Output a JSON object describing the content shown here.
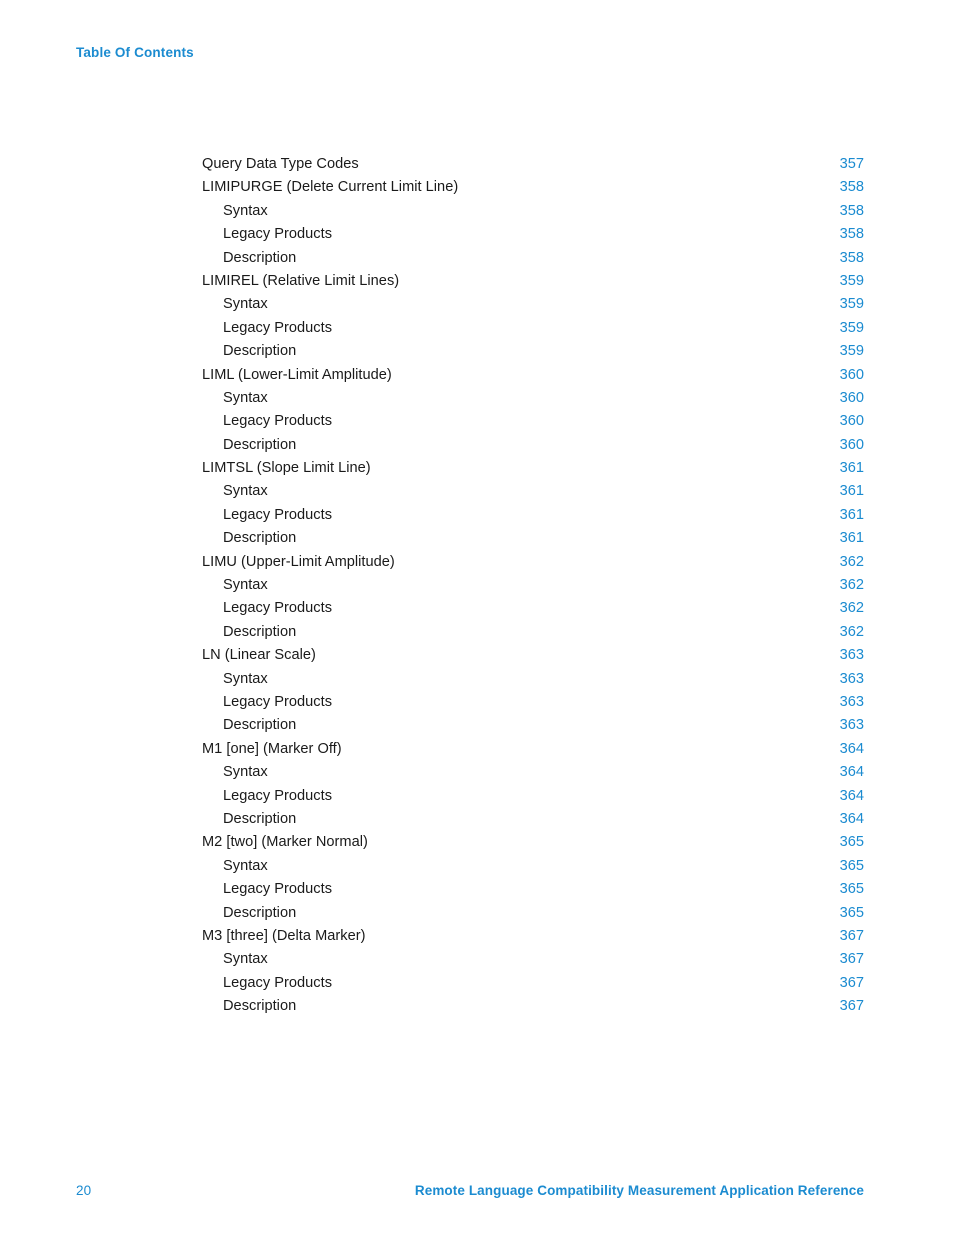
{
  "document": {
    "running_header": "Table Of Contents",
    "page_number": "20",
    "footer_title": "Remote Language Compatibility Measurement Application Reference"
  },
  "colors": {
    "link_blue": "#1b8bd0",
    "body_text": "#1a1a1a",
    "page_background": "#ffffff"
  },
  "toc": {
    "entries": [
      {
        "label": "Query Data Type Codes",
        "page": "357",
        "level": 1
      },
      {
        "label": "LIMIPURGE (Delete Current Limit Line)",
        "page": "358",
        "level": 1
      },
      {
        "label": "Syntax",
        "page": "358",
        "level": 2
      },
      {
        "label": "Legacy Products",
        "page": "358",
        "level": 2
      },
      {
        "label": "Description",
        "page": "358",
        "level": 2
      },
      {
        "label": "LIMIREL (Relative Limit Lines)",
        "page": "359",
        "level": 1
      },
      {
        "label": "Syntax",
        "page": "359",
        "level": 2
      },
      {
        "label": "Legacy Products",
        "page": "359",
        "level": 2
      },
      {
        "label": "Description",
        "page": "359",
        "level": 2
      },
      {
        "label": "LIML (Lower-Limit Amplitude)",
        "page": "360",
        "level": 1
      },
      {
        "label": "Syntax",
        "page": "360",
        "level": 2
      },
      {
        "label": "Legacy Products",
        "page": "360",
        "level": 2
      },
      {
        "label": "Description",
        "page": "360",
        "level": 2
      },
      {
        "label": "LIMTSL (Slope Limit Line)",
        "page": "361",
        "level": 1
      },
      {
        "label": "Syntax",
        "page": "361",
        "level": 2
      },
      {
        "label": "Legacy Products",
        "page": "361",
        "level": 2
      },
      {
        "label": "Description",
        "page": "361",
        "level": 2
      },
      {
        "label": "LIMU (Upper-Limit Amplitude)",
        "page": "362",
        "level": 1
      },
      {
        "label": "Syntax",
        "page": "362",
        "level": 2
      },
      {
        "label": "Legacy Products",
        "page": "362",
        "level": 2
      },
      {
        "label": "Description",
        "page": "362",
        "level": 2
      },
      {
        "label": "LN (Linear Scale)",
        "page": "363",
        "level": 1
      },
      {
        "label": "Syntax",
        "page": "363",
        "level": 2
      },
      {
        "label": "Legacy Products",
        "page": "363",
        "level": 2
      },
      {
        "label": "Description",
        "page": "363",
        "level": 2
      },
      {
        "label": "M1 [one] (Marker Off)",
        "page": "364",
        "level": 1
      },
      {
        "label": "Syntax",
        "page": "364",
        "level": 2
      },
      {
        "label": "Legacy Products",
        "page": "364",
        "level": 2
      },
      {
        "label": "Description",
        "page": "364",
        "level": 2
      },
      {
        "label": "M2 [two] (Marker Normal)",
        "page": "365",
        "level": 1
      },
      {
        "label": "Syntax",
        "page": "365",
        "level": 2
      },
      {
        "label": "Legacy Products",
        "page": "365",
        "level": 2
      },
      {
        "label": "Description",
        "page": "365",
        "level": 2
      },
      {
        "label": "M3 [three] (Delta Marker)",
        "page": "367",
        "level": 1
      },
      {
        "label": "Syntax",
        "page": "367",
        "level": 2
      },
      {
        "label": "Legacy Products",
        "page": "367",
        "level": 2
      },
      {
        "label": "Description",
        "page": "367",
        "level": 2
      }
    ]
  }
}
